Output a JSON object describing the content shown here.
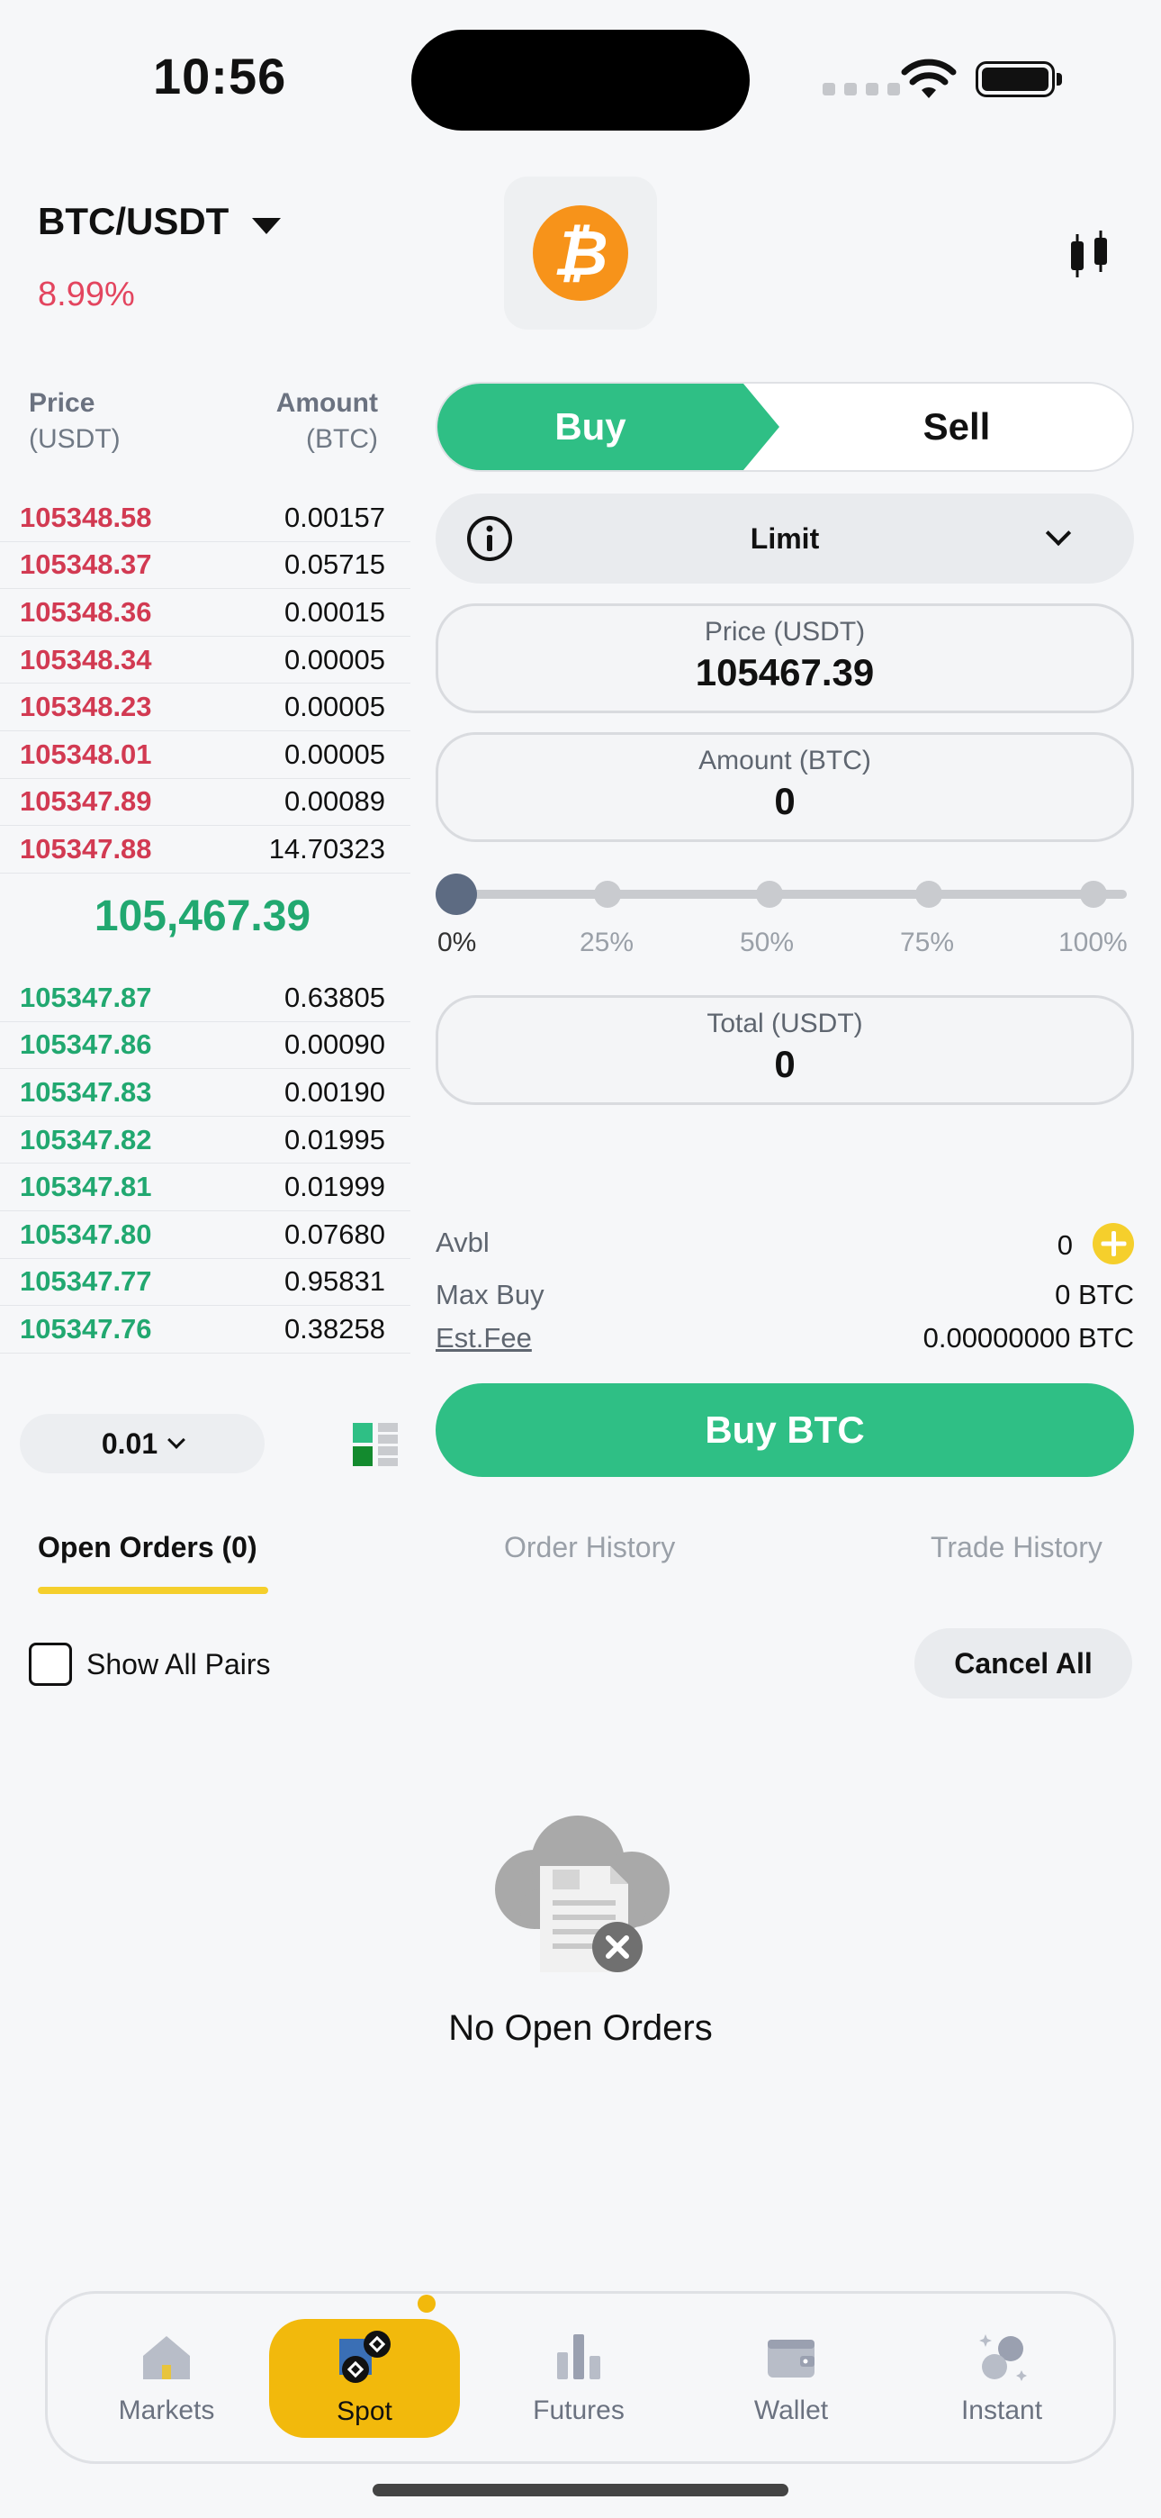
{
  "status_bar": {
    "time": "10:56"
  },
  "header": {
    "pair": "BTC/USDT",
    "change": "8.99%",
    "coin_icon": "bitcoin-icon",
    "chart_icon": "candlestick-icon"
  },
  "order_book": {
    "price_header": "Price",
    "price_unit": "(USDT)",
    "amount_header": "Amount",
    "amount_unit": "(BTC)",
    "asks": [
      {
        "price": "105348.58",
        "amount": "0.00157"
      },
      {
        "price": "105348.37",
        "amount": "0.05715"
      },
      {
        "price": "105348.36",
        "amount": "0.00015"
      },
      {
        "price": "105348.34",
        "amount": "0.00005"
      },
      {
        "price": "105348.23",
        "amount": "0.00005"
      },
      {
        "price": "105348.01",
        "amount": "0.00005"
      },
      {
        "price": "105347.89",
        "amount": "0.00089"
      },
      {
        "price": "105347.88",
        "amount": "14.70323"
      }
    ],
    "mid_price": "105,467.39",
    "bids": [
      {
        "price": "105347.87",
        "amount": "0.63805"
      },
      {
        "price": "105347.86",
        "amount": "0.00090"
      },
      {
        "price": "105347.83",
        "amount": "0.00190"
      },
      {
        "price": "105347.82",
        "amount": "0.01995"
      },
      {
        "price": "105347.81",
        "amount": "0.01999"
      },
      {
        "price": "105347.80",
        "amount": "0.07680"
      },
      {
        "price": "105347.77",
        "amount": "0.95831"
      },
      {
        "price": "105347.76",
        "amount": "0.38258"
      }
    ],
    "depth": "0.01"
  },
  "trade": {
    "buy_label": "Buy",
    "sell_label": "Sell",
    "order_type": "Limit",
    "price_label": "Price (USDT)",
    "price_value": "105467.39",
    "amount_label": "Amount (BTC)",
    "amount_value": "0",
    "slider_value": 0,
    "slider_marks": [
      "0%",
      "25%",
      "50%",
      "75%",
      "100%"
    ],
    "total_label": "Total (USDT)",
    "total_value": "0",
    "avbl_label": "Avbl",
    "avbl_value": "0",
    "max_buy_label": "Max Buy",
    "max_buy_value": "0 BTC",
    "fee_label": "Est.Fee",
    "fee_value": "0.00000000 BTC",
    "submit_label": "Buy BTC"
  },
  "orders": {
    "tabs": [
      "Open Orders (0)",
      "Order History",
      "Trade History"
    ],
    "show_all_pairs": "Show All Pairs",
    "cancel_all": "Cancel All",
    "empty_text": "No Open Orders"
  },
  "nav": {
    "items": [
      {
        "label": "Markets",
        "icon": "markets-icon"
      },
      {
        "label": "Spot",
        "icon": "spot-icon"
      },
      {
        "label": "Futures",
        "icon": "futures-icon"
      },
      {
        "label": "Wallet",
        "icon": "wallet-icon"
      },
      {
        "label": "Instant",
        "icon": "instant-icon"
      }
    ]
  },
  "colors": {
    "buy": "#2fbf85",
    "sell": "#d23a52",
    "accent": "#f2b90c"
  }
}
